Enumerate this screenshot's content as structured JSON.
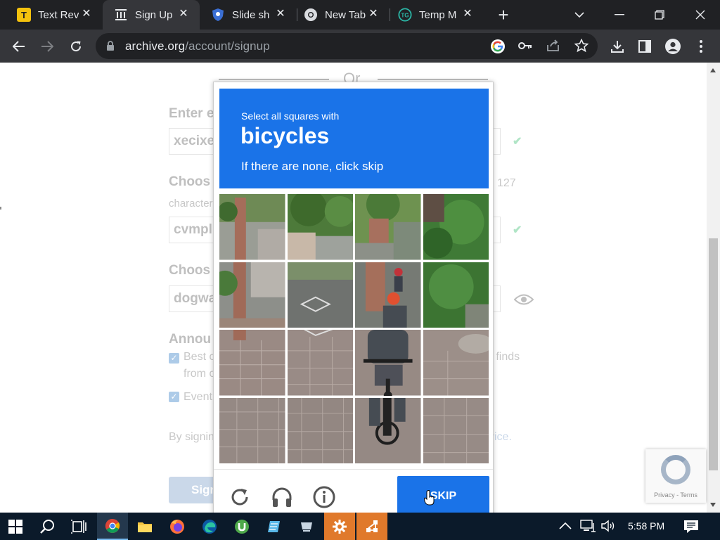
{
  "browser": {
    "tabs": [
      {
        "title": "Text Rev",
        "icon": "text-review-icon",
        "active": false
      },
      {
        "title": "Sign Up",
        "icon": "archive-icon",
        "active": true
      },
      {
        "title": "Slide sh",
        "icon": "slideshare-icon",
        "active": false
      },
      {
        "title": "New Tab",
        "icon": "chrome-icon",
        "active": false
      },
      {
        "title": "Temp M",
        "icon": "temp-mail-icon",
        "active": false
      }
    ],
    "url_host": "archive.org",
    "url_path": "/account/signup"
  },
  "form": {
    "email_label": "Enter e",
    "email_value": "xecixe",
    "username_label": "Choos",
    "username_hint_right": "127",
    "username_hint_left": "character",
    "username_value": "cvmpl",
    "password_label": "Choos",
    "password_value": "dogwa",
    "announce_label": "Annou",
    "checkbox1_label": "Best o",
    "checkbox1_label_right": "n finds",
    "checkbox1_line2": "from o",
    "checkbox2_label": "Event",
    "terms_left": "By signin",
    "terms_right": "vice.",
    "signup_button": "Sign",
    "or_text": "Or"
  },
  "captcha": {
    "line1": "Select all squares with",
    "target": "bicycles",
    "line3": "If there are none, click skip",
    "skip_label": "SKIP",
    "grid_rows": 4,
    "grid_cols": 4
  },
  "recaptcha_badge": {
    "terms": "Privacy - Terms"
  },
  "taskbar": {
    "time": "5:58 PM"
  },
  "colors": {
    "captcha_blue": "#1a73e8",
    "chrome_dark": "#202124",
    "chrome_toolbar": "#35363a",
    "taskbar": "#0b1a2a",
    "taskbar_highlight": "#e0792b"
  }
}
